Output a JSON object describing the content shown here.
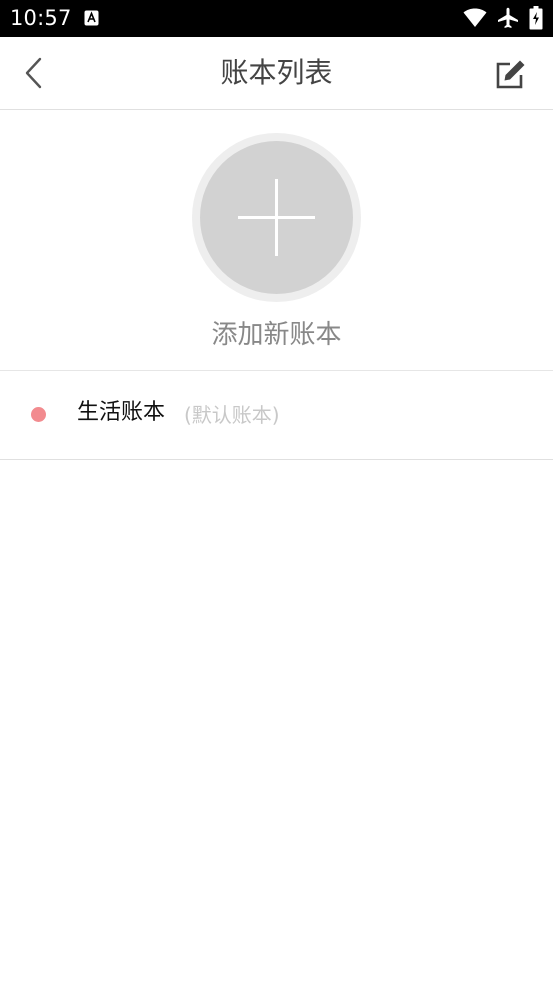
{
  "status_bar": {
    "time": "10:57"
  },
  "header": {
    "title": "账本列表"
  },
  "add_section": {
    "label": "添加新账本"
  },
  "books": [
    {
      "name": "生活账本",
      "tag": "(默认账本)",
      "dot_color": "#f28b8f"
    }
  ],
  "colors": {
    "status_bar_bg": "#000000",
    "title_text": "#444444",
    "add_circle_outer": "#eeeeee",
    "add_circle_inner": "#d2d2d2",
    "add_label_text": "#888888",
    "tag_text": "#c8c8c8"
  },
  "icons": {
    "back": "chevron-left-icon",
    "edit": "edit-icon",
    "add": "plus-icon",
    "wifi": "wifi-icon",
    "airplane": "airplane-icon",
    "battery": "battery-icon",
    "notification": "a-icon"
  }
}
